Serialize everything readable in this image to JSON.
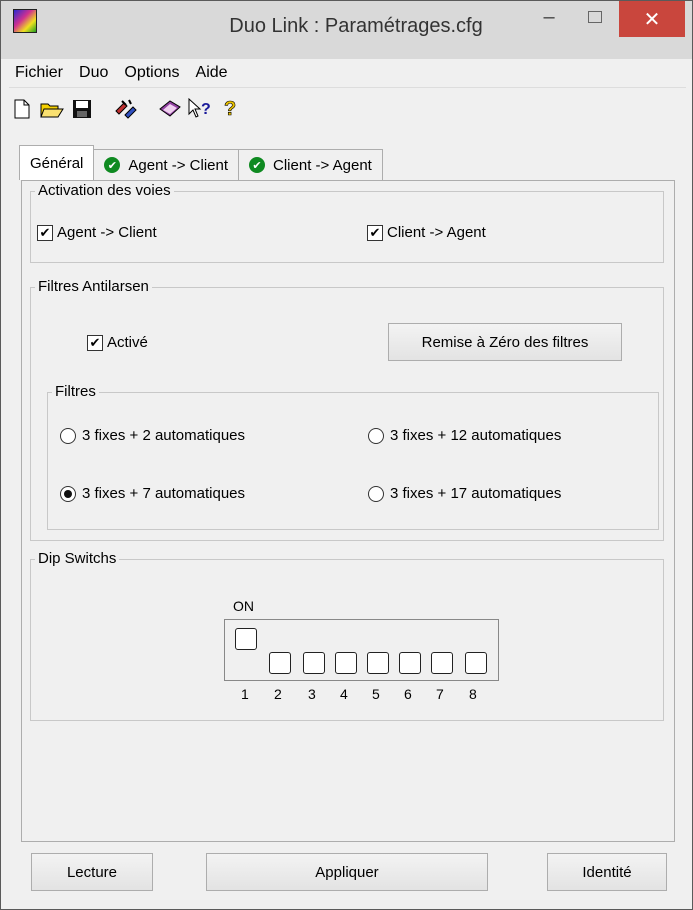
{
  "window": {
    "title": "Duo Link : Paramétrages.cfg"
  },
  "menu": [
    "Fichier",
    "Duo",
    "Options",
    "Aide"
  ],
  "tabs": [
    {
      "label": "Général",
      "active": true,
      "checked": false
    },
    {
      "label": "Agent -> Client",
      "active": false,
      "checked": true
    },
    {
      "label": "Client -> Agent",
      "active": false,
      "checked": true
    }
  ],
  "activation": {
    "legend": "Activation des voies",
    "agent_client": {
      "label": "Agent -> Client",
      "checked": true
    },
    "client_agent": {
      "label": "Client -> Agent",
      "checked": true
    }
  },
  "antilarsen": {
    "legend": "Filtres Antilarsen",
    "active": {
      "label": "Activé",
      "checked": true
    },
    "reset_button": "Remise à Zéro des filtres",
    "filters": {
      "legend": "Filtres",
      "options": [
        {
          "label": "3 fixes + 2 automatiques",
          "selected": false
        },
        {
          "label": "3 fixes + 12 automatiques",
          "selected": false
        },
        {
          "label": "3 fixes + 7 automatiques",
          "selected": true
        },
        {
          "label": "3 fixes + 17 automatiques",
          "selected": false
        }
      ]
    }
  },
  "dip": {
    "legend": "Dip Switchs",
    "on_label": "ON",
    "switches": [
      {
        "num": "1",
        "on": true
      },
      {
        "num": "2",
        "on": false
      },
      {
        "num": "3",
        "on": false
      },
      {
        "num": "4",
        "on": false
      },
      {
        "num": "5",
        "on": false
      },
      {
        "num": "6",
        "on": false
      },
      {
        "num": "7",
        "on": false
      },
      {
        "num": "8",
        "on": false
      }
    ]
  },
  "buttons": {
    "read": "Lecture",
    "apply": "Appliquer",
    "identity": "Identité"
  },
  "colors": {
    "close_button": "#c9463d",
    "tab_check": "#0f8a21"
  }
}
